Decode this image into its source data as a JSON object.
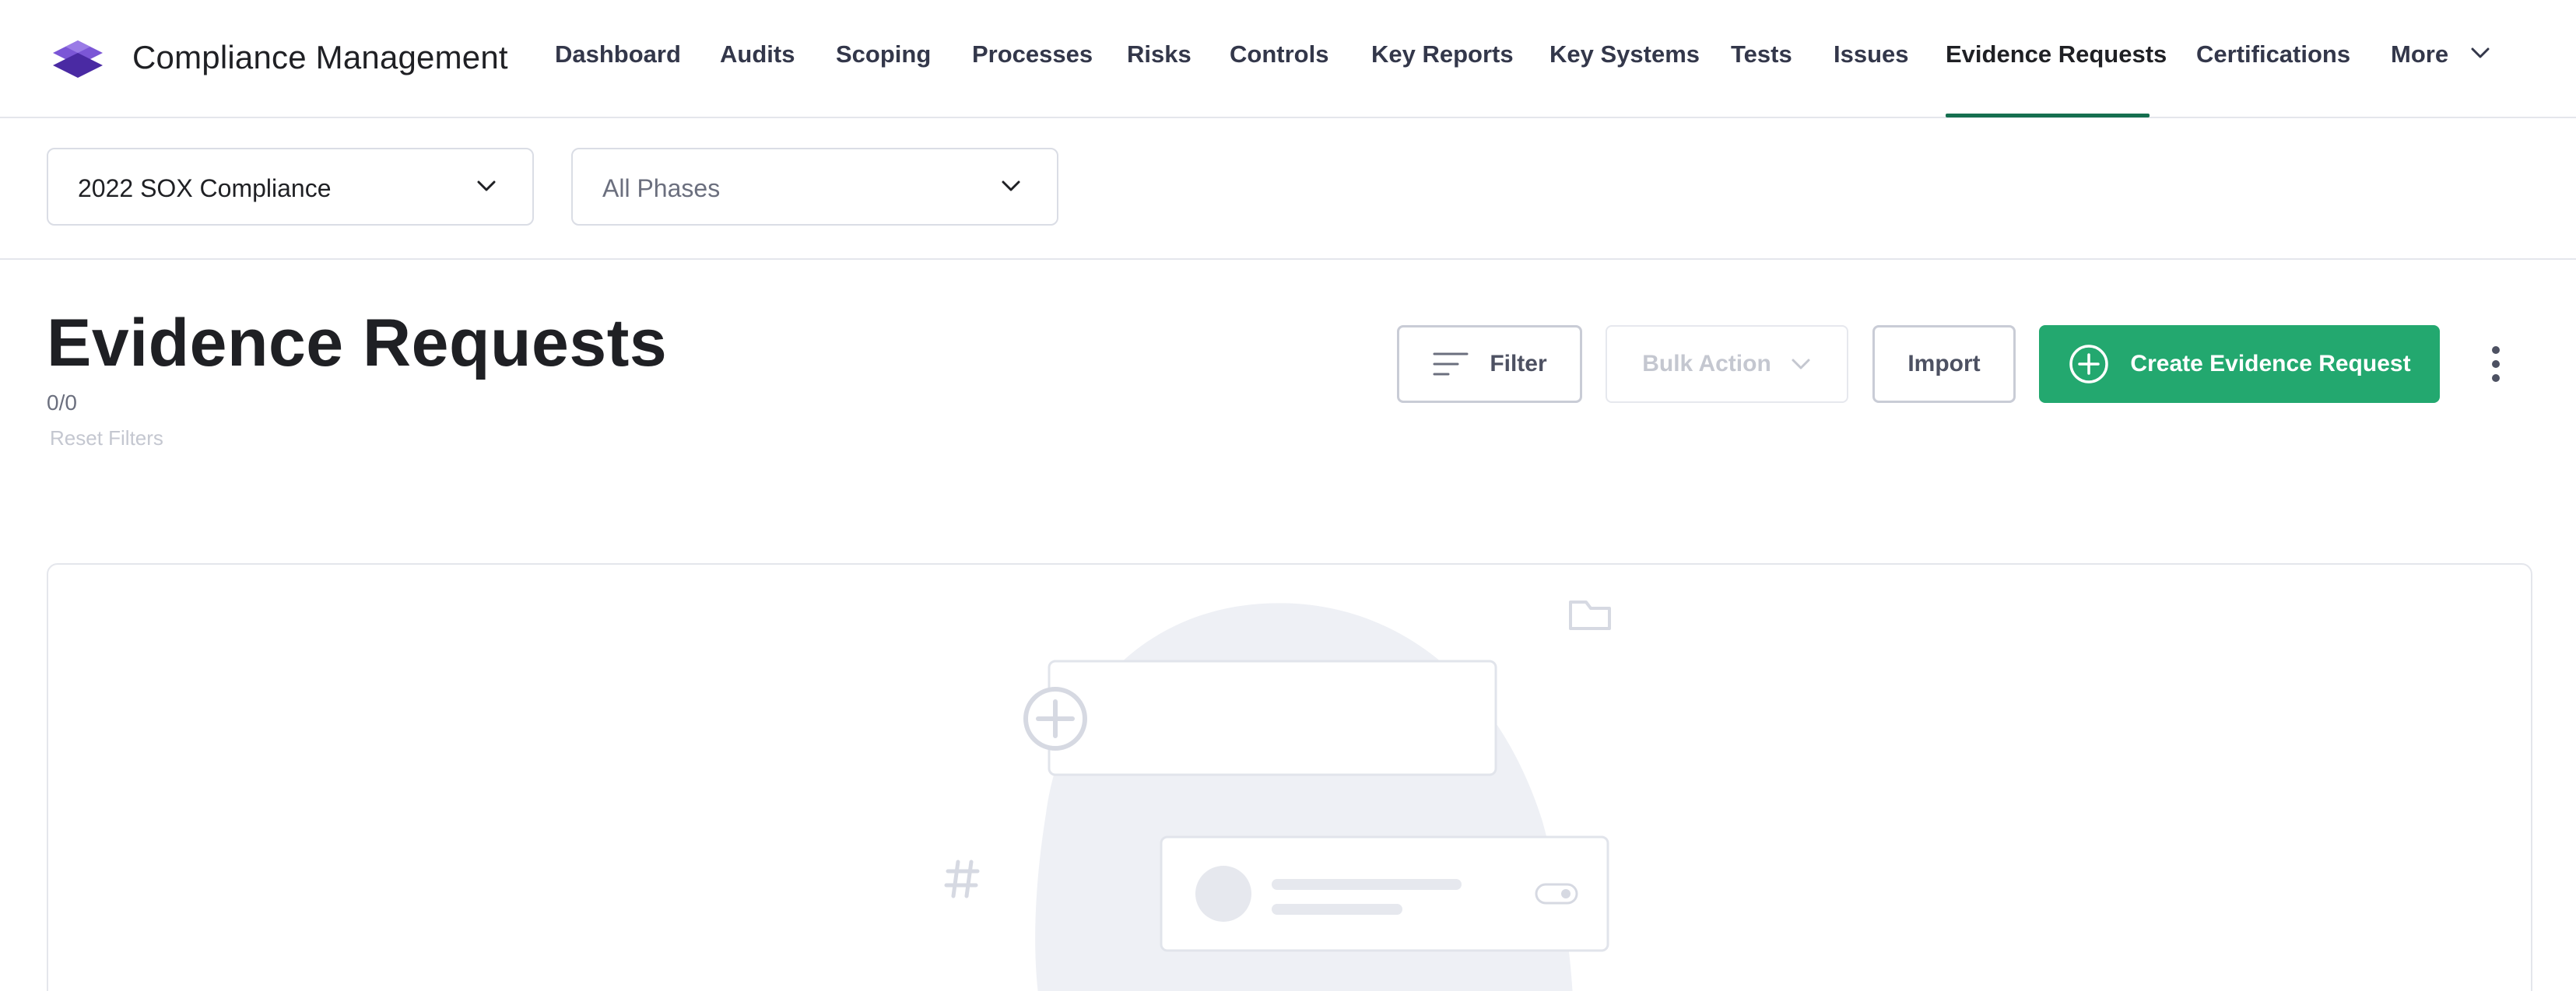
{
  "app": {
    "title": "Compliance Management",
    "logo_icon": "layers-logo-icon",
    "brand_color": "#6a3fc4"
  },
  "nav": {
    "items": [
      {
        "label": "Dashboard"
      },
      {
        "label": "Audits"
      },
      {
        "label": "Scoping"
      },
      {
        "label": "Processes"
      },
      {
        "label": "Risks"
      },
      {
        "label": "Controls"
      },
      {
        "label": "Key Reports"
      },
      {
        "label": "Key Systems"
      },
      {
        "label": "Tests"
      },
      {
        "label": "Issues"
      },
      {
        "label": "Evidence Requests",
        "active": true
      },
      {
        "label": "Certifications"
      },
      {
        "label": "More"
      }
    ],
    "active_color": "#156f4f"
  },
  "filters": {
    "compliance_select": {
      "value": "2022 SOX Compliance"
    },
    "phase_select": {
      "value": "All Phases"
    }
  },
  "page": {
    "title": "Evidence Requests",
    "count": "0/0",
    "reset_filters": "Reset Filters"
  },
  "toolbar": {
    "filter_label": "Filter",
    "bulk_action_label": "Bulk Action",
    "import_label": "Import",
    "create_label": "Create Evidence Request",
    "create_color": "#23a86f"
  },
  "empty_state": {
    "icons": [
      "folder-icon",
      "plus-circle-icon",
      "hash-icon",
      "toggle-icon",
      "avatar-icon"
    ]
  }
}
